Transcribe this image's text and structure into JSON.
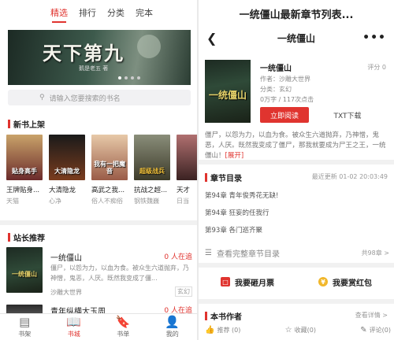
{
  "left": {
    "tabs": [
      "精选",
      "排行",
      "分类",
      "完本"
    ],
    "banner": {
      "title": "天下第九",
      "subtitle": "鹅是老五 著"
    },
    "search": {
      "placeholder": "请输入您要搜索的书名"
    },
    "new_books": {
      "title": "新书上架",
      "items": [
        {
          "title": "王牌贴身...",
          "author": "天猫",
          "cover_text": "贴身高手",
          "color": "#6b2b2b"
        },
        {
          "title": "大清隐龙",
          "author": "心净",
          "cover_text": "大清隐龙",
          "color": "#3a2a1c"
        },
        {
          "title": "高武之我...",
          "author": "俗人不痴俗",
          "cover_text": "我有一把魔音",
          "color": "#8a6a58"
        },
        {
          "title": "抗战之超...",
          "author": "钢铁魏巍",
          "cover_text": "超级战兵",
          "color": "#4a4f3b"
        },
        {
          "title": "天才",
          "author": "日当",
          "cover_text": "",
          "color": "#5b3a3a"
        }
      ]
    },
    "recommend": {
      "title": "站长推荐",
      "items": [
        {
          "title": "一统僵山",
          "count": "0 人在追",
          "desc": "僵尸，以怨为力，以血为食。被众生六道抛弃，乃神憎，鬼恶，人厌。既然我变成了僵...",
          "author": "沙雕大世界",
          "genre": "玄幻",
          "cover_text": "一统僵山"
        },
        {
          "title": "青年纵横大玉周",
          "count": "0 人在追"
        }
      ]
    },
    "bottom_nav": [
      {
        "label": "书架",
        "icon": "bookshelf-icon",
        "glyph": "▤"
      },
      {
        "label": "书城",
        "icon": "bookstore-icon",
        "glyph": "📖"
      },
      {
        "label": "书单",
        "icon": "booklist-icon",
        "glyph": "🔖"
      },
      {
        "label": "我的",
        "icon": "profile-icon",
        "glyph": "👤"
      }
    ]
  },
  "right": {
    "page_title": "一统僵山最新章节列表...",
    "header_title": "一统僵山",
    "book": {
      "name": "一统僵山",
      "score": "评分 0",
      "author": "作者：沙雕大世界",
      "category": "分类：玄幻",
      "stats": "0万字 / 117次点击",
      "read_button": "立即阅读",
      "txt_button": "TXT下载",
      "cover_text": "一统僵山",
      "description": "僵尸，以怨为力，以血为食。被众生六道抛弃，乃神憎，鬼恶，人厌。既然我变成了僵尸，那我就要成为尸王之王，一统僵山！",
      "expand": "[展开]"
    },
    "chapters": {
      "title": "章节目录",
      "updated": "最近更新 01-02 20:03:49",
      "items": [
        "第94章 青年俊秀花无缺!",
        "第94章 狂妄的任我行",
        "第93章 各门巡齐聚"
      ],
      "full_label": "查看完整章节目录",
      "count": "共98章 >"
    },
    "actions": {
      "vote": "我要砸月票",
      "reward": "我要赏红包"
    },
    "author_section": {
      "title": "本书作者",
      "view_more": "查看详情 >"
    },
    "bottom_row": [
      "推荐 (0)",
      "收藏(0)",
      "评论(0)"
    ]
  }
}
